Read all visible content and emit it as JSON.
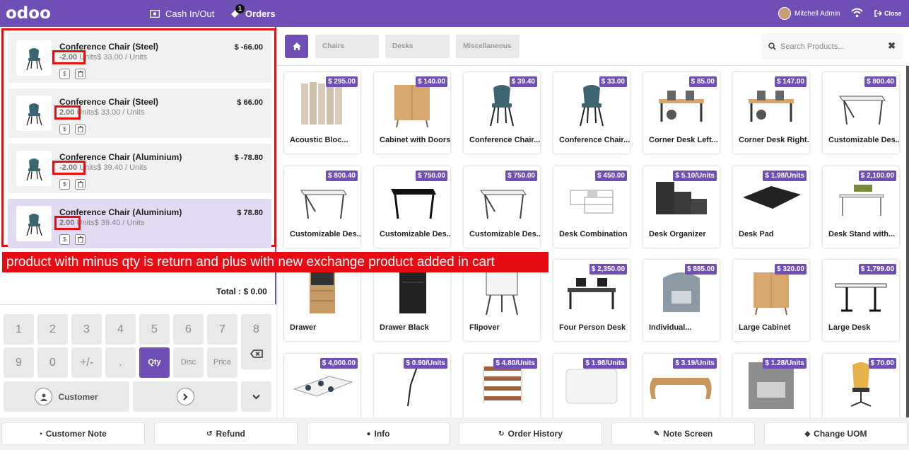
{
  "header": {
    "logo": "odoo",
    "cash_label": "Cash In/Out",
    "orders_label": "Orders",
    "orders_count": "1",
    "user_name": "Mitchell Admin",
    "close_label": "Close"
  },
  "order_lines": [
    {
      "name": "Conference Chair (Steel)",
      "qty": "-2.00",
      "unit_info": "Units$ 33.00 / Units",
      "price": "$ -66.00",
      "selected": false
    },
    {
      "name": "Conference Chair (Steel)",
      "qty": "2.00",
      "unit_info": "Units$ 33.00 / Units",
      "price": "$ 66.00",
      "selected": false
    },
    {
      "name": "Conference Chair (Aluminium)",
      "qty": "-2.00",
      "unit_info": "Units$ 39.40 / Units",
      "price": "$ -78.80",
      "selected": false
    },
    {
      "name": "Conference Chair (Aluminium)",
      "qty": "2.00",
      "unit_info": "Units$ 39.40 / Units",
      "price": "$ 78.80",
      "selected": true
    }
  ],
  "annotation": "product  with minus qty is return and plus  with new exchange  product added in cart",
  "total": "Total : $ 0.00",
  "numpad": {
    "row1": [
      "1",
      "2",
      "3",
      "4",
      "5",
      "6",
      "7",
      "8"
    ],
    "row2": [
      "9",
      "0",
      "+/-",
      ".",
      "Qty",
      "Disc",
      "Price"
    ],
    "customer_label": "Customer"
  },
  "categories": {
    "items": [
      "Chairs",
      "Desks",
      "Miscellaneous"
    ],
    "search_placeholder": "Search Products..."
  },
  "products": [
    {
      "name": "Acoustic Bloc...",
      "price": "$ 295.00",
      "icon": "acoustic-panel"
    },
    {
      "name": "Cabinet with Doors",
      "price": "$ 140.00",
      "icon": "cabinet"
    },
    {
      "name": "Conference Chair...",
      "price": "$ 39.40",
      "icon": "chair"
    },
    {
      "name": "Conference Chair...",
      "price": "$ 33.00",
      "icon": "chair"
    },
    {
      "name": "Corner Desk Left...",
      "price": "$ 85.00",
      "icon": "office-desk"
    },
    {
      "name": "Corner Desk Right...",
      "price": "$ 147.00",
      "icon": "office-desk"
    },
    {
      "name": "Customizable Des...",
      "price": "$ 800.40",
      "icon": "table"
    },
    {
      "name": "Customizable Des...",
      "price": "$ 800.40",
      "icon": "table"
    },
    {
      "name": "Customizable Des...",
      "price": "$ 750.00",
      "icon": "black-table"
    },
    {
      "name": "Customizable Des...",
      "price": "$ 750.00",
      "icon": "table"
    },
    {
      "name": "Desk Combination",
      "price": "$ 450.00",
      "icon": "desk-combo"
    },
    {
      "name": "Desk Organizer",
      "price": "$ 5.10/Units",
      "icon": "organizer"
    },
    {
      "name": "Desk Pad",
      "price": "$ 1.98/Units",
      "icon": "desk-pad"
    },
    {
      "name": "Desk Stand with...",
      "price": "$ 2,100.00",
      "icon": "desk-stand"
    },
    {
      "name": "Drawer",
      "price": "",
      "icon": "drawer"
    },
    {
      "name": "Drawer Black",
      "price": "",
      "icon": "drawer-black"
    },
    {
      "name": "Flipover",
      "price": "",
      "icon": "flipover"
    },
    {
      "name": "Four Person Desk",
      "price": "$ 2,350.00",
      "icon": "four-desk"
    },
    {
      "name": "Individual...",
      "price": "$ 885.00",
      "icon": "booth"
    },
    {
      "name": "Large Cabinet",
      "price": "$ 320.00",
      "icon": "cabinet"
    },
    {
      "name": "Large Desk",
      "price": "$ 1,799.00",
      "icon": "large-desk"
    },
    {
      "name": "",
      "price": "$ 4,000.00",
      "icon": "meeting-desk"
    },
    {
      "name": "",
      "price": "$ 0.90/Units",
      "icon": "cable"
    },
    {
      "name": "",
      "price": "$ 4.80/Units",
      "icon": "shelves"
    },
    {
      "name": "",
      "price": "$ 1.98/Units",
      "icon": "pad-white"
    },
    {
      "name": "",
      "price": "$ 3.19/Units",
      "icon": "monitor-stand"
    },
    {
      "name": "",
      "price": "$ 1.28/Units",
      "icon": "metal-plate"
    },
    {
      "name": "",
      "price": "$ 70.00",
      "icon": "office-chair"
    }
  ],
  "bottom_buttons": [
    "Customer Note",
    "Refund",
    "Info",
    "Order History",
    "Note Screen",
    "Change UOM"
  ],
  "colors": {
    "accent": "#6f4fb6",
    "annotation": "#e80d14"
  }
}
